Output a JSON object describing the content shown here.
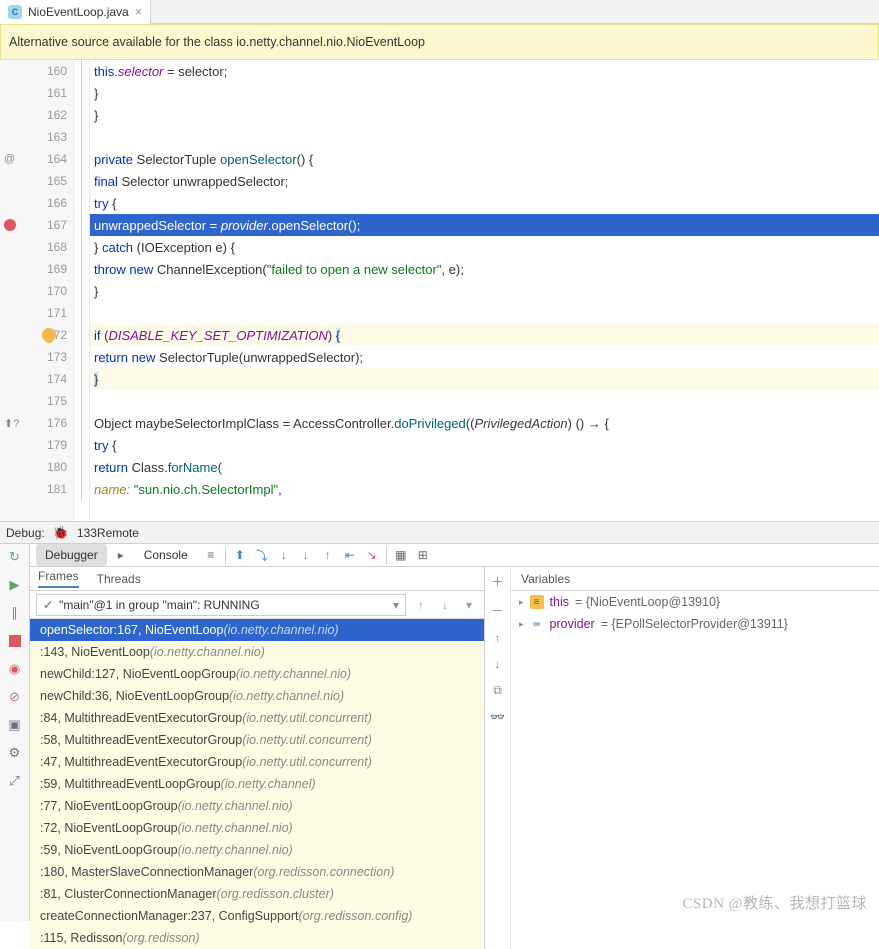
{
  "tab": {
    "filename": "NioEventLoop.java",
    "icon_letter": "C"
  },
  "info_bar": "Alternative source available for the class io.netty.channel.nio.NioEventLoop",
  "code": {
    "lines": [
      {
        "n": "160",
        "ind": 16,
        "t": [
          [
            "kw",
            "this"
          ],
          [
            "",
            "."
          ],
          [
            "fld",
            "selector"
          ],
          [
            "",
            " = selector;"
          ]
        ]
      },
      {
        "n": "161",
        "ind": 12,
        "t": [
          [
            "",
            "}"
          ]
        ]
      },
      {
        "n": "162",
        "ind": 8,
        "t": [
          [
            "",
            "}"
          ]
        ]
      },
      {
        "n": "163",
        "ind": 0,
        "t": [
          [
            "",
            ""
          ]
        ]
      },
      {
        "n": "164",
        "ann": "@",
        "ind": 8,
        "t": [
          [
            "kw",
            "private"
          ],
          [
            "",
            " SelectorTuple "
          ],
          [
            "mth",
            "openSelector"
          ],
          [
            "",
            "() {"
          ]
        ]
      },
      {
        "n": "165",
        "ind": 12,
        "t": [
          [
            "kw",
            "final"
          ],
          [
            "",
            " Selector "
          ],
          [
            "",
            "unwrappedSelector;"
          ]
        ]
      },
      {
        "n": "166",
        "ind": 12,
        "t": [
          [
            "kw",
            "try"
          ],
          [
            "",
            " {"
          ]
        ]
      },
      {
        "n": "167",
        "bp": true,
        "exec": true,
        "ind": 16,
        "t": [
          [
            "",
            "unwrappedSelector = "
          ],
          [
            "fld",
            "provider"
          ],
          [
            "",
            ".openSelector();"
          ]
        ]
      },
      {
        "n": "168",
        "ind": 12,
        "t": [
          [
            "",
            "} "
          ],
          [
            "kw",
            "catch"
          ],
          [
            "",
            " (IOException e) {"
          ]
        ]
      },
      {
        "n": "169",
        "ind": 16,
        "t": [
          [
            "kw",
            "throw new"
          ],
          [
            "",
            " ChannelException("
          ],
          [
            "str",
            "\"failed to open a new selector\""
          ],
          [
            "",
            ", e);"
          ]
        ]
      },
      {
        "n": "170",
        "ind": 12,
        "t": [
          [
            "",
            "}"
          ]
        ]
      },
      {
        "n": "171",
        "ind": 0,
        "t": [
          [
            "",
            ""
          ]
        ]
      },
      {
        "n": "172",
        "bulb": true,
        "warn": true,
        "ind": 12,
        "t": [
          [
            "kw",
            "if"
          ],
          [
            "",
            " ("
          ],
          [
            "cst",
            "DISABLE_KEY_SET_OPTIMIZATION"
          ],
          [
            "",
            ") "
          ],
          [
            "sel-brace",
            "{"
          ]
        ]
      },
      {
        "n": "173",
        "ind": 16,
        "t": [
          [
            "kw",
            "return new"
          ],
          [
            "",
            " SelectorTuple(unwrappedSelector);"
          ]
        ]
      },
      {
        "n": "174",
        "warn": true,
        "ind": 12,
        "t": [
          [
            "sel-brace",
            "}"
          ]
        ]
      },
      {
        "n": "175",
        "ind": 0,
        "t": [
          [
            "",
            ""
          ]
        ]
      },
      {
        "n": "176",
        "ann": "⬆?",
        "ind": 12,
        "t": [
          [
            "",
            "Object maybeSelectorImplClass = AccessController."
          ],
          [
            "mth",
            "doPrivileged"
          ],
          [
            "",
            "(("
          ],
          [
            "prm",
            "PrivilegedAction"
          ],
          [
            "",
            ") () → {"
          ]
        ]
      },
      {
        "n": "179",
        "ind": 20,
        "t": [
          [
            "kw",
            "try"
          ],
          [
            "",
            " {"
          ]
        ]
      },
      {
        "n": "180",
        "ind": 24,
        "t": [
          [
            "kw",
            "return"
          ],
          [
            "",
            " Class."
          ],
          [
            "mth",
            "forName"
          ],
          [
            "",
            "("
          ]
        ]
      },
      {
        "n": "181",
        "ind": 32,
        "t": [
          [
            "lbl",
            "name: "
          ],
          [
            "str",
            "\"sun.nio.ch.SelectorImpl\""
          ],
          [
            "",
            ","
          ]
        ]
      }
    ]
  },
  "debug": {
    "label": "Debug:",
    "config": "133Remote",
    "tabs": {
      "debugger": "Debugger",
      "console": "Console"
    },
    "subtabs": {
      "frames": "Frames",
      "threads": "Threads"
    },
    "thread": "\"main\"@1 in group \"main\": RUNNING",
    "frames": [
      {
        "m": "openSelector:167, NioEventLoop ",
        "p": "(io.netty.channel.nio)",
        "sel": true
      },
      {
        "m": "<init>:143, NioEventLoop ",
        "p": "(io.netty.channel.nio)"
      },
      {
        "m": "newChild:127, NioEventLoopGroup ",
        "p": "(io.netty.channel.nio)"
      },
      {
        "m": "newChild:36, NioEventLoopGroup ",
        "p": "(io.netty.channel.nio)"
      },
      {
        "m": "<init>:84, MultithreadEventExecutorGroup ",
        "p": "(io.netty.util.concurrent)"
      },
      {
        "m": "<init>:58, MultithreadEventExecutorGroup ",
        "p": "(io.netty.util.concurrent)"
      },
      {
        "m": "<init>:47, MultithreadEventExecutorGroup ",
        "p": "(io.netty.util.concurrent)"
      },
      {
        "m": "<init>:59, MultithreadEventLoopGroup ",
        "p": "(io.netty.channel)"
      },
      {
        "m": "<init>:77, NioEventLoopGroup ",
        "p": "(io.netty.channel.nio)"
      },
      {
        "m": "<init>:72, NioEventLoopGroup ",
        "p": "(io.netty.channel.nio)"
      },
      {
        "m": "<init>:59, NioEventLoopGroup ",
        "p": "(io.netty.channel.nio)"
      },
      {
        "m": "<init>:180, MasterSlaveConnectionManager ",
        "p": "(org.redisson.connection)"
      },
      {
        "m": "<init>:81, ClusterConnectionManager ",
        "p": "(org.redisson.cluster)"
      },
      {
        "m": "createConnectionManager:237, ConfigSupport ",
        "p": "(org.redisson.config)"
      },
      {
        "m": "<init>:115, Redisson ",
        "p": "(org.redisson)"
      }
    ],
    "variables_label": "Variables",
    "vars": [
      {
        "ico": "y",
        "name": "this",
        "val": " = {NioEventLoop@13910}"
      },
      {
        "ico": "b",
        "name": "provider",
        "val": " = {EPollSelectorProvider@13911}"
      }
    ]
  },
  "watermark": "CSDN @教练、我想打篮球"
}
